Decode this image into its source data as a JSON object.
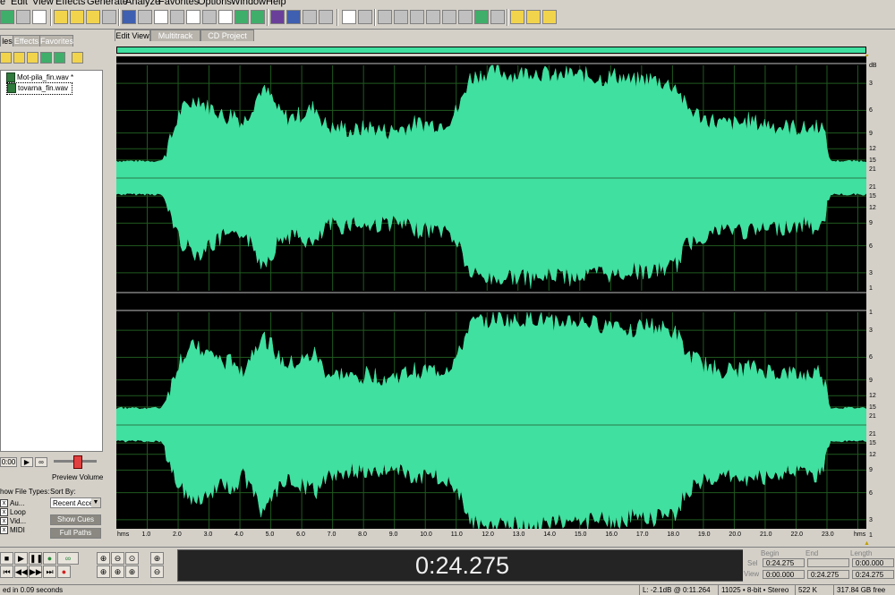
{
  "menu": [
    "e",
    "Edit",
    "View",
    "Effects",
    "Generate",
    "Analyze",
    "Favorites",
    "Options",
    "Window",
    "Help"
  ],
  "left_panel": {
    "tabs": [
      "les",
      "Effects",
      "Favorites"
    ],
    "files": [
      "Mot-pila_fin.wav *",
      "tovarna_fin.wav"
    ],
    "preview_time": "0:00",
    "preview_volume_label": "Preview Volume",
    "show_file_types_label": "how File Types:",
    "sort_by_label": "Sort By:",
    "sort_by_value": "Recent Acce",
    "file_types": [
      "Au...",
      "Loop",
      "Vid...",
      "MIDI"
    ],
    "show_cues": "Show Cues",
    "full_paths": "Full Paths"
  },
  "view_tabs": [
    "Edit View",
    "Multitrack View",
    "CD Project View"
  ],
  "db_scale_top": [
    "dB",
    "3",
    "6",
    "9",
    "12",
    "15",
    "21",
    "21",
    "15",
    "12",
    "9",
    "6",
    "3",
    "1"
  ],
  "db_scale_bottom": [
    "1",
    "3",
    "6",
    "9",
    "12",
    "15",
    "21",
    "21",
    "15",
    "12",
    "9",
    "6",
    "3",
    "1"
  ],
  "time_ruler": [
    "hms",
    "1.0",
    "2.0",
    "3.0",
    "4.0",
    "5.0",
    "6.0",
    "7.0",
    "8.0",
    "9.0",
    "10.0",
    "11.0",
    "12.0",
    "13.0",
    "14.0",
    "15.0",
    "16.0",
    "17.0",
    "18.0",
    "19.0",
    "20.0",
    "21.0",
    "22.0",
    "23.0",
    "hms"
  ],
  "time_display": "0:24.275",
  "selection": {
    "headers": [
      "Begin",
      "End",
      "Length"
    ],
    "sel_label": "Sel",
    "view_label": "View",
    "sel": [
      "0:24.275",
      "",
      "0:00.000"
    ],
    "view": [
      "0:00.000",
      "0:24.275",
      "0:24.275"
    ]
  },
  "status": {
    "left": "ed in 0.09 seconds",
    "level": "L: -2.1dB @   0:11.264",
    "format": "11025 • 8-bit • Stereo",
    "size": "522 K",
    "free": "317.84 GB free"
  },
  "colors": {
    "waveform": "#40e0a0",
    "wave_bg": "#000000",
    "grid": "#1f5a1f"
  },
  "waveform_envelope": [
    0.14,
    0.14,
    0.14,
    0.14,
    0.14,
    0.14,
    0.3,
    0.55,
    0.62,
    0.68,
    0.6,
    0.58,
    0.5,
    0.55,
    0.45,
    0.6,
    0.75,
    0.7,
    0.55,
    0.5,
    0.52,
    0.55,
    0.6,
    0.45,
    0.4,
    0.42,
    0.38,
    0.4,
    0.42,
    0.4,
    0.38,
    0.4,
    0.42,
    0.45,
    0.45,
    0.45,
    0.45,
    0.5,
    0.6,
    0.85,
    0.88,
    0.9,
    0.92,
    0.9,
    0.88,
    0.9,
    0.92,
    0.9,
    0.88,
    0.86,
    0.9,
    0.88,
    0.88,
    0.86,
    0.85,
    0.88,
    0.86,
    0.82,
    0.84,
    0.85,
    0.83,
    0.8,
    0.78,
    0.6,
    0.55,
    0.5,
    0.48,
    0.45,
    0.45,
    0.45,
    0.48,
    0.45,
    0.45,
    0.43,
    0.42,
    0.42,
    0.4,
    0.42,
    0.45,
    0.14,
    0.14,
    0.14,
    0.14,
    0.14
  ]
}
